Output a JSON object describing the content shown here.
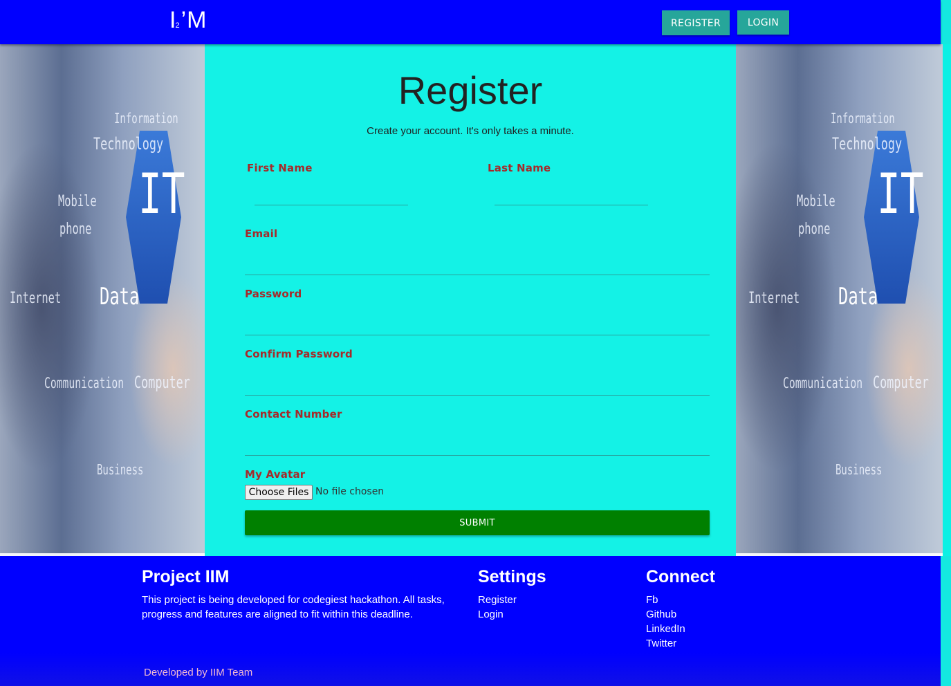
{
  "navbar": {
    "logo_main": "I",
    "logo_sub": "2",
    "logo_tail": "’M",
    "register_label": "REGISTER",
    "login_label": "LOGIN"
  },
  "form": {
    "title": "Register",
    "subtitle": "Create your account. It's only takes a minute.",
    "first_name_label": "First Name",
    "last_name_label": "Last Name",
    "email_label": "Email",
    "password_label": "Password",
    "confirm_password_label": "Confirm Password",
    "contact_label": "Contact Number",
    "avatar_label": "My Avatar",
    "choose_files_label": "Choose Files",
    "file_status": "No file chosen",
    "submit_label": "SUBMIT"
  },
  "background_image": {
    "words": [
      "Information",
      "Technology",
      "Mobile",
      "phone",
      "IT",
      "Data",
      "Internet",
      "Communication",
      "Computer",
      "Business"
    ]
  },
  "footer": {
    "project_heading": "Project IIM",
    "project_text": "This project is being developed for codegiest hackathon. All tasks, progress and features are aligned to fit within this deadline.",
    "settings_heading": "Settings",
    "settings_links": [
      "Register",
      "Login"
    ],
    "connect_heading": "Connect",
    "connect_links": [
      "Fb",
      "Github",
      "LinkedIn",
      "Twitter"
    ],
    "copyright": "Developed by IIM Team"
  },
  "colors": {
    "primary_blue": "#0000ff",
    "card_cyan": "#14f2e6",
    "nav_button_teal": "#26a69a",
    "submit_green": "#008000",
    "label_brown": "#a52a2a"
  }
}
